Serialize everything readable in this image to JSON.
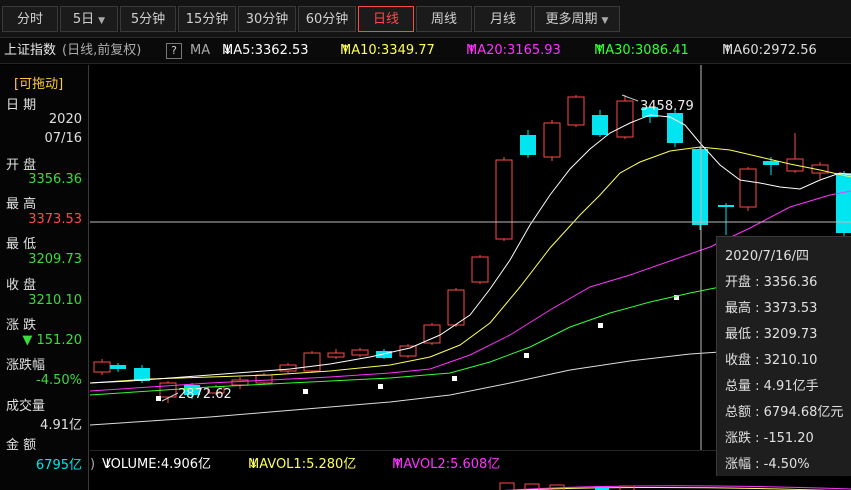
{
  "tabs": [
    {
      "label": "分时",
      "active": false
    },
    {
      "label": "5日",
      "active": false,
      "dropdown": true
    },
    {
      "label": "5分钟",
      "active": false
    },
    {
      "label": "15分钟",
      "active": false
    },
    {
      "label": "30分钟",
      "active": false
    },
    {
      "label": "60分钟",
      "active": false
    },
    {
      "label": "日线",
      "active": true
    },
    {
      "label": "周线",
      "active": false
    },
    {
      "label": "月线",
      "active": false
    },
    {
      "label": "更多周期",
      "active": false,
      "dropdown": true
    }
  ],
  "indicator": {
    "name": "上证指数",
    "params": "(日线,前复权)",
    "help": "?",
    "ma_label": "MA",
    "ma5": "MA5:3362.53",
    "ma10": "MA10:3349.77",
    "ma20": "MA20:3165.93",
    "ma30": "MA30:3086.41",
    "ma60": "MA60:2972.56",
    "arrow_down": "↓",
    "arrow_up": "↑"
  },
  "left_panel": {
    "drag": "[可拖动]",
    "date_label": "日 期",
    "date_year": "2020",
    "date_md": "07/16",
    "open_label": "开 盘",
    "open": "3356.36",
    "high_label": "最 高",
    "high": "3373.53",
    "low_label": "最 低",
    "low": "3209.73",
    "close_label": "收 盘",
    "close": "3210.10",
    "change_label": "涨 跌",
    "change": "▼ 151.20",
    "pct_label": "涨跌幅",
    "pct": "-4.50%",
    "vol_label": "成交量",
    "vol": "4.91亿",
    "amt_label": "金 额",
    "amt": "6795亿"
  },
  "chart_annotations": {
    "high_mark": "3458.79",
    "low_mark": "2872.62"
  },
  "volume": {
    "paren": ")",
    "volume": "VOLUME:4.906亿",
    "mavol1": "MAVOL1:5.280亿",
    "mavol2": "MAVOL2:5.608亿"
  },
  "tooltip": {
    "date": "2020/7/16/四",
    "open": "开盘 : 3356.36",
    "high": "最高 : 3373.53",
    "low": "最低 : 3209.73",
    "close": "收盘 : 3210.10",
    "vol": "总量 : 4.91亿手",
    "amt": "总额 : 6794.68亿元",
    "change": "涨跌 : -151.20",
    "pct": "涨幅 : -4.50%"
  },
  "colors": {
    "up": "#ff4a4a",
    "down": "#00e5f0",
    "ma5": "#ffffff",
    "ma10": "#ffff55",
    "ma20": "#ff33ff",
    "ma30": "#33ff33",
    "ma60": "#dddddd",
    "green_text": "#3cdc3c",
    "red_text": "#ff4a4a"
  }
}
